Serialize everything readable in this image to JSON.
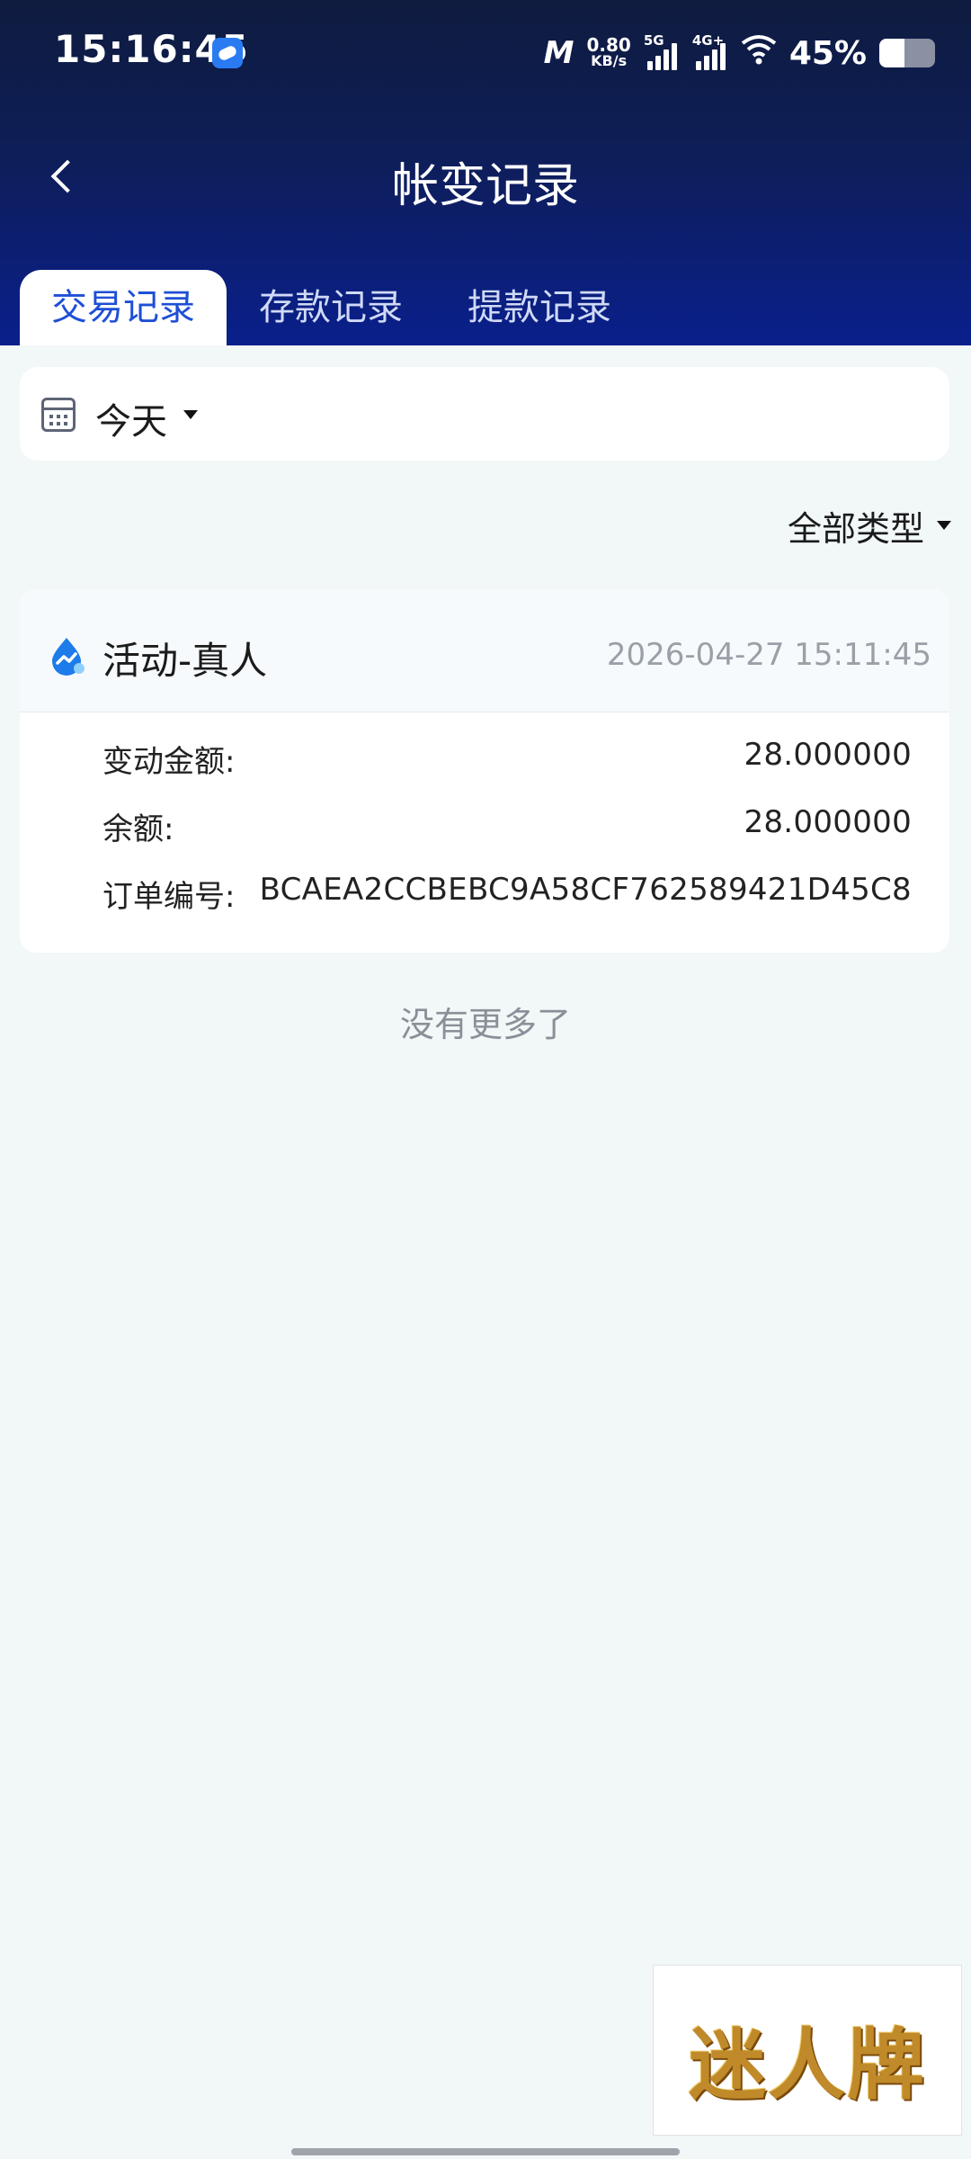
{
  "status_bar": {
    "time": "15:16:45",
    "speed_value": "0.80",
    "speed_unit": "KB/s",
    "sim1_type": "5G",
    "sim2_type": "4G+",
    "battery_percent_text": "45%",
    "battery_level": 0.45
  },
  "nav": {
    "title": "帐变记录"
  },
  "tabs": [
    {
      "label": "交易记录",
      "active": true
    },
    {
      "label": "存款记录",
      "active": false
    },
    {
      "label": "提款记录",
      "active": false
    }
  ],
  "date_filter": {
    "label": "今天"
  },
  "type_filter": {
    "label": "全部类型"
  },
  "records": [
    {
      "title": "活动-真人",
      "time": "2026-04-27 15:11:45",
      "fields": [
        {
          "key": "变动金额:",
          "value": "28.000000"
        },
        {
          "key": "余额:",
          "value": "28.000000"
        },
        {
          "key": "订单编号:",
          "value": "BCAEA2CCBEBC9A58CF762589421D45C8"
        }
      ]
    }
  ],
  "footer_text": "没有更多了",
  "watermark_logo": "迷人牌",
  "colors": {
    "header_top": "#0f1b3f",
    "header_bottom": "#0a1f8c",
    "active_tab_text": "#1f4fd6",
    "page_bg": "#f2f7f8",
    "record_icon": "#1e7bea"
  }
}
